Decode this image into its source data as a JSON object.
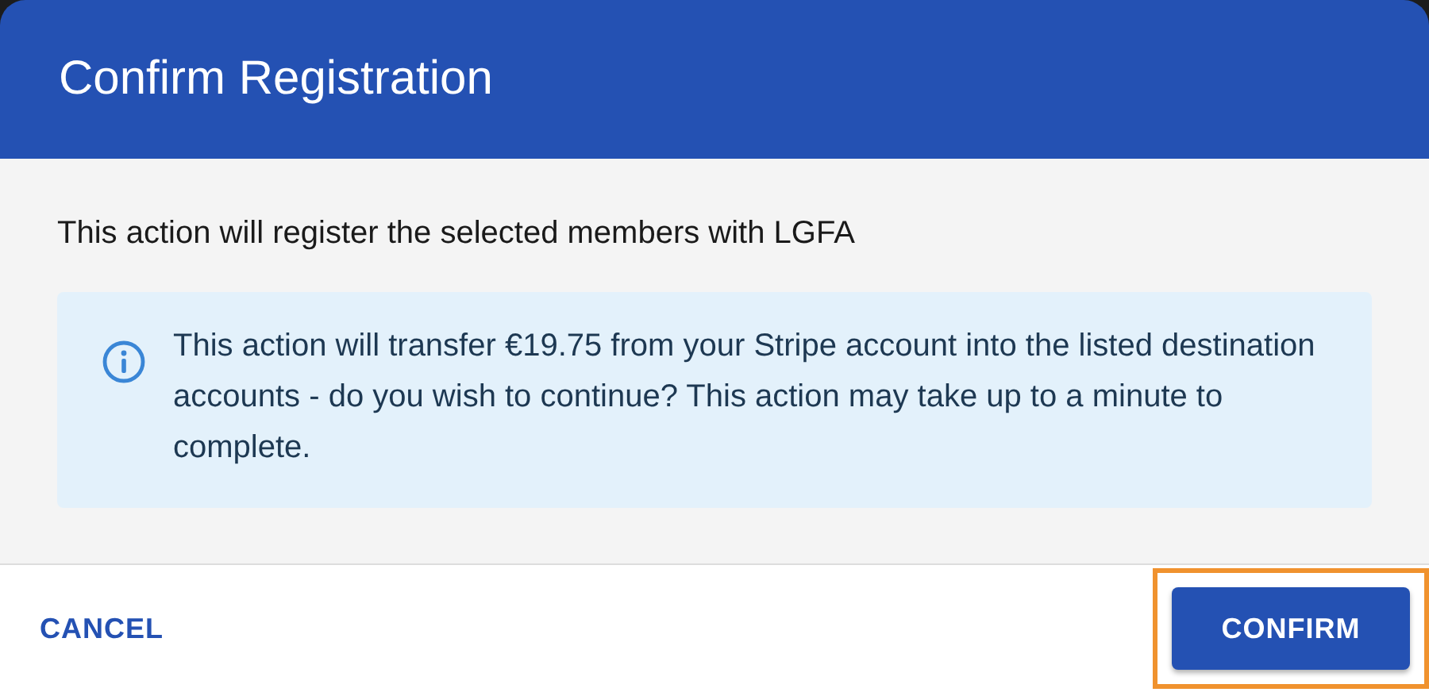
{
  "dialog": {
    "title": "Confirm Registration"
  },
  "message": "This action will register the selected members with LGFA",
  "alert": {
    "kind": "info",
    "text": "This action will transfer €19.75 from your Stripe account into the listed destination accounts - do you wish to continue? This action may take up to a minute to complete."
  },
  "buttons": [
    {
      "label": "CANCEL",
      "kind": "text",
      "focused": false
    },
    {
      "label": "CONFIRM",
      "kind": "primary",
      "focused": true
    }
  ]
}
